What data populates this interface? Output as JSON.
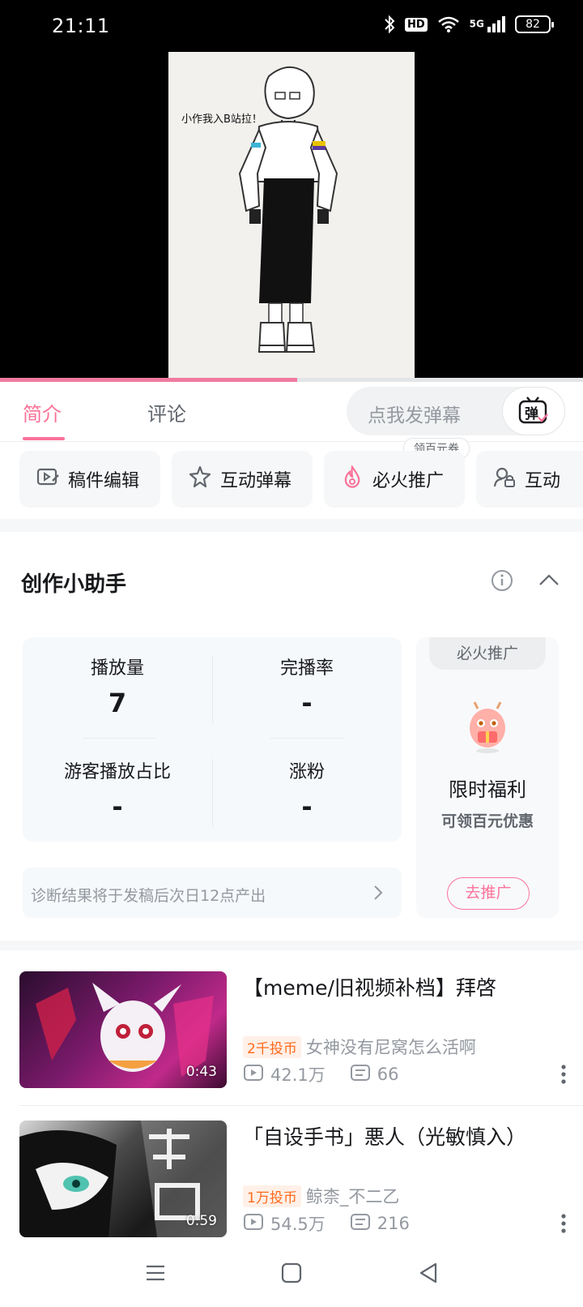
{
  "status_bar": {
    "time": "21:11",
    "network": "5G",
    "hd": "HD",
    "battery": "82",
    "icons": [
      "bluetooth-icon",
      "hd-icon",
      "wifi-icon",
      "signal-icon",
      "battery-icon"
    ]
  },
  "video": {
    "caption": "小作我入B站拉！",
    "progress_fraction": 0.51
  },
  "tabs": {
    "intro": "简介",
    "comments": "评论",
    "danmaku_placeholder": "点我发弹幕",
    "danmaku_toggle_glyph": "弹"
  },
  "actions": {
    "coupon_tag": "领百元券",
    "items": [
      {
        "label": "稿件编辑",
        "icon": "edit-video-icon"
      },
      {
        "label": "互动弹幕",
        "icon": "star-icon"
      },
      {
        "label": "必火推广",
        "icon": "fire-icon"
      },
      {
        "label": "互动",
        "icon": "lock-person-icon"
      }
    ]
  },
  "assistant": {
    "title": "创作小助手",
    "stats": [
      {
        "label": "播放量",
        "value": "7"
      },
      {
        "label": "完播率",
        "value": "-"
      },
      {
        "label": "游客播放占比",
        "value": "-"
      },
      {
        "label": "涨粉",
        "value": "-"
      }
    ],
    "diagnosis": "诊断结果将于发稿后次日12点产出",
    "promo": {
      "tab": "必火推广",
      "headline": "限时福利",
      "sub": "可领百元优惠",
      "button": "去推广"
    }
  },
  "related": [
    {
      "title": "【meme/旧视频补档】拜啓",
      "coin_badge": "2千投币",
      "author": "女神没有尼窝怎么活啊",
      "views": "42.1万",
      "comments": "66",
      "duration": "0:43"
    },
    {
      "title": "「自设手书」悪人（光敏慎入）",
      "coin_badge": "1万投币",
      "author": "鲸柰_不二乙",
      "views": "54.5万",
      "comments": "216",
      "duration": "0:59"
    }
  ],
  "colors": {
    "accent": "#fb7299",
    "coin": "#ff6b1c"
  }
}
